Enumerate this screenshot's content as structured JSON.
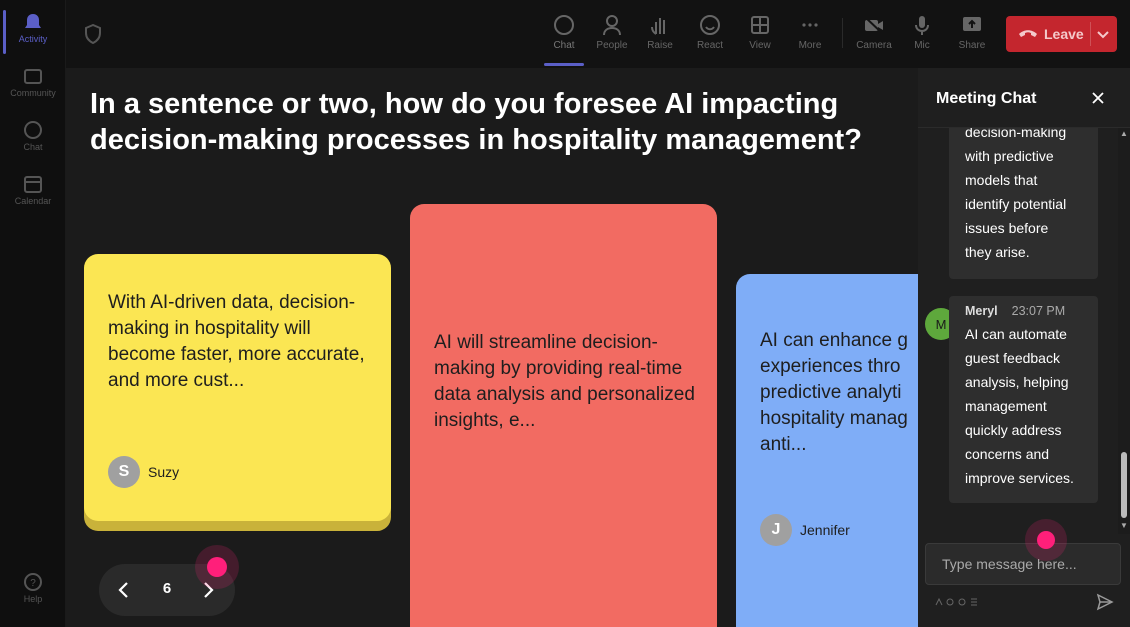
{
  "rail": {
    "items": [
      {
        "label": "Activity",
        "icon": "bell-icon",
        "active": true
      },
      {
        "label": "Community",
        "icon": "community-icon"
      },
      {
        "label": "Chat",
        "icon": "chat-icon"
      },
      {
        "label": "Calendar",
        "icon": "calendar-icon"
      }
    ],
    "help": {
      "label": "Help",
      "icon": "help-icon"
    }
  },
  "toolbar": {
    "buttons": [
      {
        "label": "Chat",
        "icon": "chat-icon",
        "active": true
      },
      {
        "label": "People",
        "icon": "people-icon"
      },
      {
        "label": "Raise",
        "icon": "raise-hand-icon"
      },
      {
        "label": "React",
        "icon": "smiley-icon"
      },
      {
        "label": "View",
        "icon": "grid-icon"
      },
      {
        "label": "More",
        "icon": "more-dots-icon"
      },
      {
        "label": "Camera",
        "icon": "camera-off-icon"
      },
      {
        "label": "Mic",
        "icon": "mic-icon"
      },
      {
        "label": "Share",
        "icon": "share-icon"
      }
    ],
    "leave_label": "Leave"
  },
  "stage": {
    "question": "In a sentence or two, how do you foresee AI impacting decision-making processes in hospitality management?",
    "cards": [
      {
        "text": "With AI-driven data, decision-making in hospitality will become faster, more accurate, and more cust...",
        "author": "Suzy",
        "initial": "S",
        "color": "#fbe653"
      },
      {
        "text": "AI will streamline decision-making by providing real-time data analysis and personalized insights, e...",
        "color": "#f26b62"
      },
      {
        "text_lines": [
          "AI can enhance g",
          "experiences thro",
          "predictive analyti",
          "hospitality manag",
          "anti..."
        ],
        "author": "Jennifer",
        "initial": "J",
        "color": "#7fadf7"
      }
    ],
    "pager": {
      "page": "6"
    }
  },
  "chat": {
    "title": "Meeting Chat",
    "messages": [
      {
        "lines": [
          "decision-making",
          "with predictive",
          "models that",
          "identify potential",
          "issues before",
          "they arise."
        ]
      },
      {
        "author": "Meryl",
        "initial": "M",
        "time": "23:07 PM",
        "lines": [
          "AI can automate",
          "guest feedback",
          "analysis, helping",
          "management",
          "quickly address",
          "concerns and",
          "improve services."
        ]
      }
    ],
    "input_placeholder": "Type message here..."
  },
  "colors": {
    "accent": "#5b5fc7",
    "leave": "#c4262e",
    "cursor": "#ff1f7a"
  }
}
